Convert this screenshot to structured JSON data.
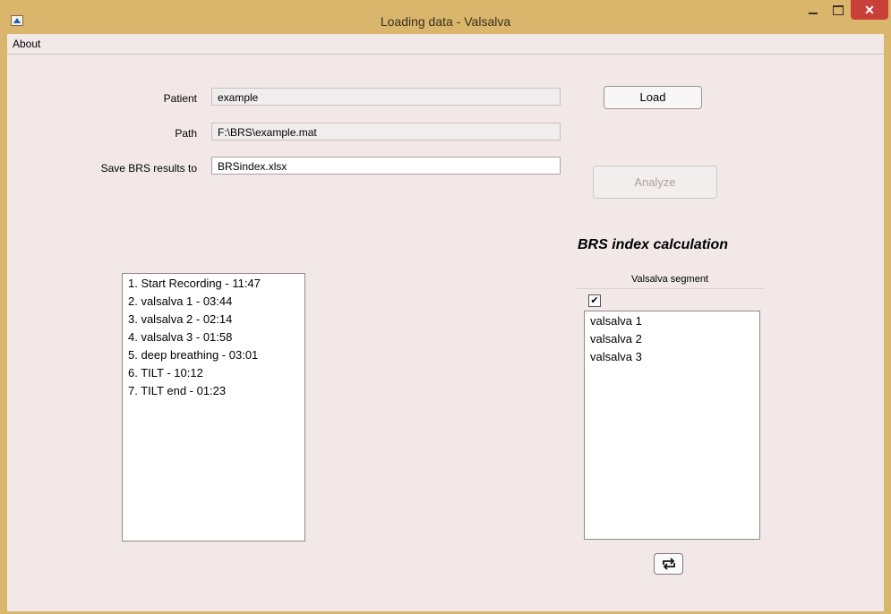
{
  "window": {
    "title": "Loading data - Valsalva",
    "close_glyph": "✕"
  },
  "menu": {
    "about": "About"
  },
  "form": {
    "patient_label": "Patient",
    "patient_value": "example",
    "path_label": "Path",
    "path_value": "F:\\BRS\\example.mat",
    "save_label": "Save BRS results to",
    "save_value": "BRSindex.xlsx"
  },
  "buttons": {
    "load": "Load",
    "analyze": "Analyze"
  },
  "events_list": [
    "1. Start Recording - 11:47",
    "2. valsalva 1 - 03:44",
    "3. valsalva 2 - 02:14",
    "4. valsalva 3 - 01:58",
    "5. deep breathing - 03:01",
    "6. TILT - 10:12",
    "7. TILT end - 01:23"
  ],
  "brs": {
    "section_title": "BRS index calculation",
    "column_header": "Valsalva segment",
    "checkbox_glyph": "✔",
    "segments": [
      "valsalva 1",
      "valsalva 2",
      "valsalva 3"
    ]
  },
  "icons": {
    "refresh": "refresh-icon",
    "app": "matlab-icon"
  }
}
